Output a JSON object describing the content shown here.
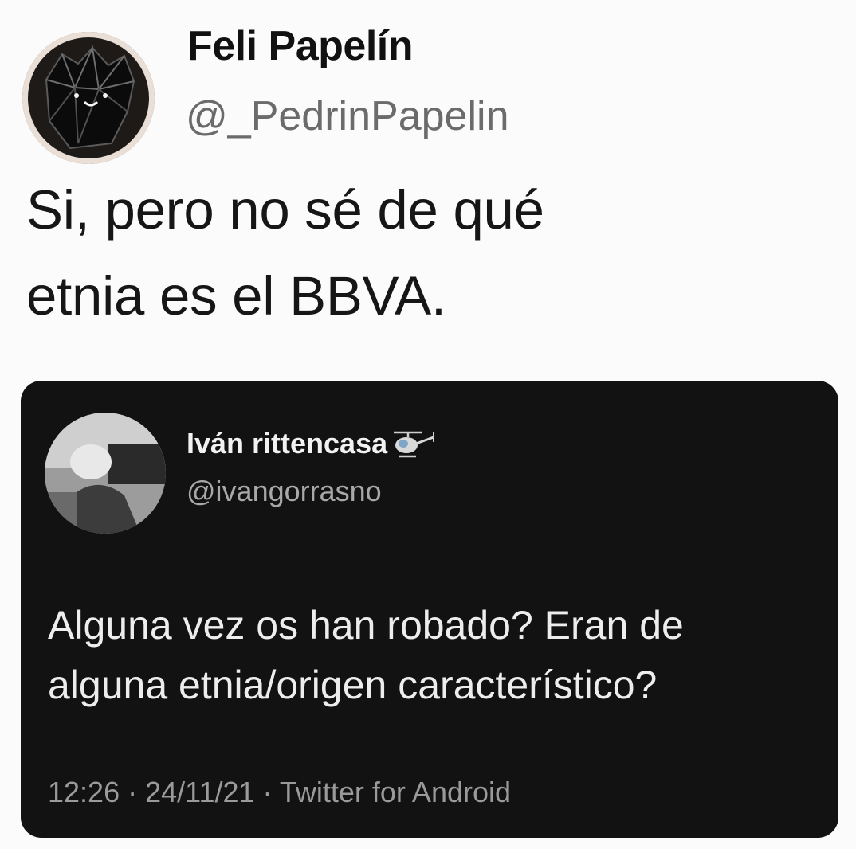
{
  "outer_tweet": {
    "display_name": "Feli Papelín",
    "handle": "@_PedrinPapelin",
    "text_lines": [
      "Si, pero no sé de qué",
      "etnia es el BBVA."
    ],
    "avatar_icon": "dark-crystal-creature-avatar"
  },
  "quoted_tweet": {
    "display_name": "Iván rittencasa",
    "name_emoji_icon": "helicopter-icon",
    "handle": "@ivangorrasno",
    "text_lines": [
      "Alguna vez os han robado? Eran de",
      "alguna etnia/origen característico?"
    ],
    "meta": "12:26 · 24/11/21 · Twitter for Android",
    "avatar_icon": "grayscale-photo-avatar"
  },
  "colors": {
    "page_background": "#fbfbfb",
    "card_background": "#121212",
    "outer_handle": "#6b6b6b",
    "inner_handle": "#a8a8a8"
  }
}
